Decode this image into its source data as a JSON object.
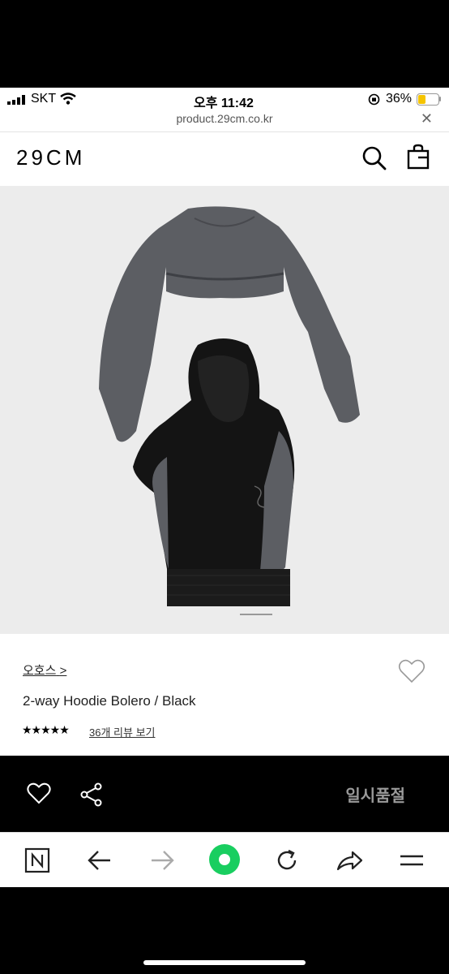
{
  "status": {
    "carrier": "SKT",
    "time": "오후 11:42",
    "battery": "36%"
  },
  "urlbar": {
    "url": "product.29cm.co.kr",
    "close": "✕"
  },
  "header": {
    "logo": "29CM",
    "icons": [
      "search-icon",
      "bag-icon"
    ]
  },
  "product": {
    "brand": "오호스",
    "brand_chevron": ">",
    "name": "2-way Hoodie Bolero / Black",
    "stars": "★★★★★",
    "reviews_link": "36개 리뷰 보기"
  },
  "actionbar": {
    "soldout_label": "일시품절",
    "icons": [
      "heart-outline-icon",
      "share-icon"
    ]
  },
  "browser_nav": {
    "icons": [
      "naver-n-icon",
      "back-arrow-icon",
      "forward-arrow-icon",
      "green-home-icon",
      "reload-icon",
      "share-arrow-icon",
      "menu-icon"
    ]
  },
  "colors": {
    "accent_green": "#19ce60",
    "battery_yellow": "#f5c400"
  }
}
